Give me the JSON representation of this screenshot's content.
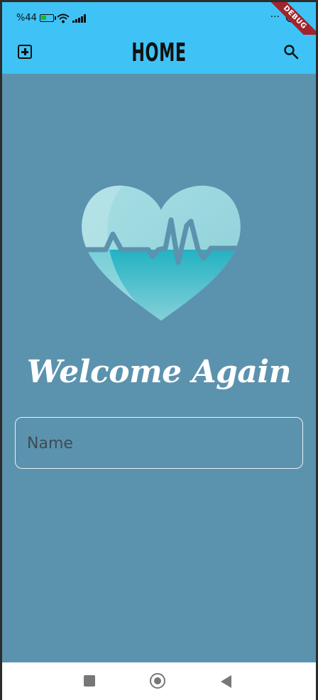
{
  "status_bar": {
    "battery_level": "44",
    "carrier": "",
    "battery_percent": 0.44
  },
  "debug_banner": "DEBUG",
  "app_bar": {
    "title": "HOME",
    "add_icon": "add-box-icon",
    "search_icon": "search-icon"
  },
  "main": {
    "welcome_text": "Welcome Again",
    "name_field": {
      "placeholder": "Name",
      "value": ""
    }
  },
  "nav_bar": {
    "recent_icon": "square-icon",
    "home_icon": "circle-icon",
    "back_icon": "triangle-back-icon"
  },
  "colors": {
    "app_bar": "#3fc3f6",
    "background": "#5b93ae",
    "heart_light": "#a6dbe2",
    "heart_teal": "#2bb7c3"
  }
}
